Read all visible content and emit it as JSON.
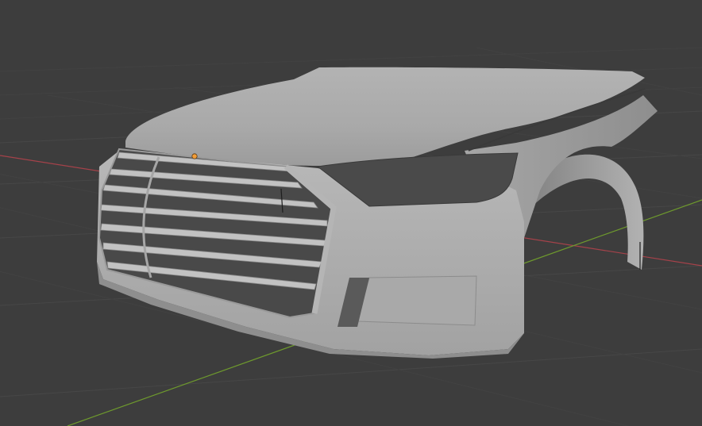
{
  "app": "Blender",
  "viewport": {
    "background_color": "#3d3d3d",
    "grid_color": "#474747",
    "x_axis_color": "#a5424a",
    "y_axis_color": "#6e9a2d",
    "origin_color": "#f29d38",
    "model_color": "#bcbcbc",
    "model": "car-front-body",
    "selected_object_origin": true
  }
}
